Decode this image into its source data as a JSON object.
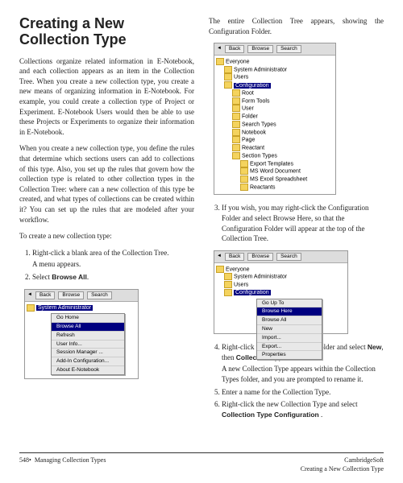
{
  "title": "Creating a New Collection Type",
  "intro_p1": "Collections organize related information in E-Notebook, and each collection appears as an item in the Collection Tree. When you create a new collection type, you create a new means of organizing information in E-Notebook. For example, you could create a collection type of Project or Experiment. E-Notebook Users would then be able to use these Projects or Experiments to organize their information in E-Notebook.",
  "intro_p2": "When you create a new collection type, you define the rules that determine which sections users can add to collections of this type. Also, you set up the rules that govern how the collection type is related to other collection types in the Collection Tree: where can a new collection of this type be created, and what types of collections can be created within it? You can set up the rules that are modeled after your workflow.",
  "lead": "To create a new collection type:",
  "steps_left": [
    {
      "n": "1.",
      "text": "Right-click a blank area of the Collection Tree.",
      "sub": "A menu appears."
    },
    {
      "n": "2.",
      "text": "Select ",
      "bold": "Browse All",
      "after": "."
    }
  ],
  "right_intro": "The entire Collection Tree appears, showing the Configuration Folder.",
  "steps_right_a": [
    {
      "n": "3.",
      "text": "If you wish, you may right-click the Configuration Folder and select Browse Here, so that the Configuration Folder will appear at the top of the Collection Tree."
    }
  ],
  "steps_right_b": [
    {
      "n": "4.",
      "text": "Right-click the Collection Types folder and select ",
      "bold1": "New",
      "mid": ", then ",
      "bold2": "Collection Type",
      "after": ".",
      "sub": "A new Collection Type appears within the Collection Types folder, and you are prompted to rename it."
    },
    {
      "n": "5.",
      "text": "Enter a name for the Collection Type."
    },
    {
      "n": "6.",
      "text": "Right-click the new Collection Type and select ",
      "bold1": "Collection Type Configuration",
      "after": " ."
    }
  ],
  "toolbar": {
    "back": "Back",
    "browse": "Browse",
    "search": "Search"
  },
  "menu1": [
    "Go Home",
    "Browse All",
    "Refresh",
    "User Info...",
    "Session Manager ...",
    "Add-In Configuration...",
    "About E-Notebook"
  ],
  "tree1_root": "Everyone",
  "tree1": [
    "System Administrator",
    "Users"
  ],
  "tree1_cfg": "Configuration",
  "tree1_children": [
    "Root",
    "Form Tools",
    "User",
    "Folder",
    "Search Types",
    "Notebook",
    "Page",
    "Reactant",
    "Section Types",
    "Export Templates",
    "MS Word Document",
    "MS Excel Spreadsheet",
    "Reactants"
  ],
  "menu2": [
    "Go Up To",
    "Browse Here",
    "Browse All",
    "New",
    "Import...",
    "Export...",
    "Properties"
  ],
  "tree2_top": [
    "Everyone",
    "System Administrator",
    "Users"
  ],
  "footer": {
    "page": "548•",
    "left": "Managing Collection Types",
    "right1": "CambridgeSoft",
    "right2": "Creating a New Collection Type"
  }
}
